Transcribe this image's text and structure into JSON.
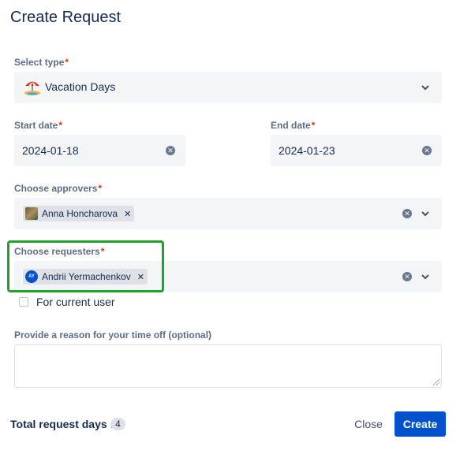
{
  "dialog": {
    "title": "Create Request"
  },
  "select_type": {
    "label": "Select type",
    "required_mark": "*",
    "value": "Vacation Days",
    "icon": "beach-umbrella-icon"
  },
  "start_date": {
    "label": "Start date",
    "required_mark": "*",
    "value": "2024-01-18"
  },
  "end_date": {
    "label": "End date",
    "required_mark": "*",
    "value": "2024-01-23"
  },
  "approvers": {
    "label": "Choose approvers",
    "required_mark": "*",
    "selected": [
      {
        "name": "Anna Honcharova",
        "avatar": "photo"
      }
    ]
  },
  "requesters": {
    "label": "Choose requesters",
    "required_mark": "*",
    "selected": [
      {
        "name": "Andrii Yermachenkov",
        "initials": "AY"
      }
    ]
  },
  "current_user_checkbox": {
    "label": "For current user",
    "checked": false
  },
  "reason": {
    "label": "Provide a reason for your time off (optional)",
    "value": ""
  },
  "footer": {
    "total_label": "Total request days :",
    "total_value": "4",
    "close_label": "Close",
    "create_label": "Create"
  },
  "colors": {
    "primary": "#0052cc",
    "highlight": "#1ba32c",
    "required": "#de350b",
    "field_bg": "#f4f5f7"
  }
}
